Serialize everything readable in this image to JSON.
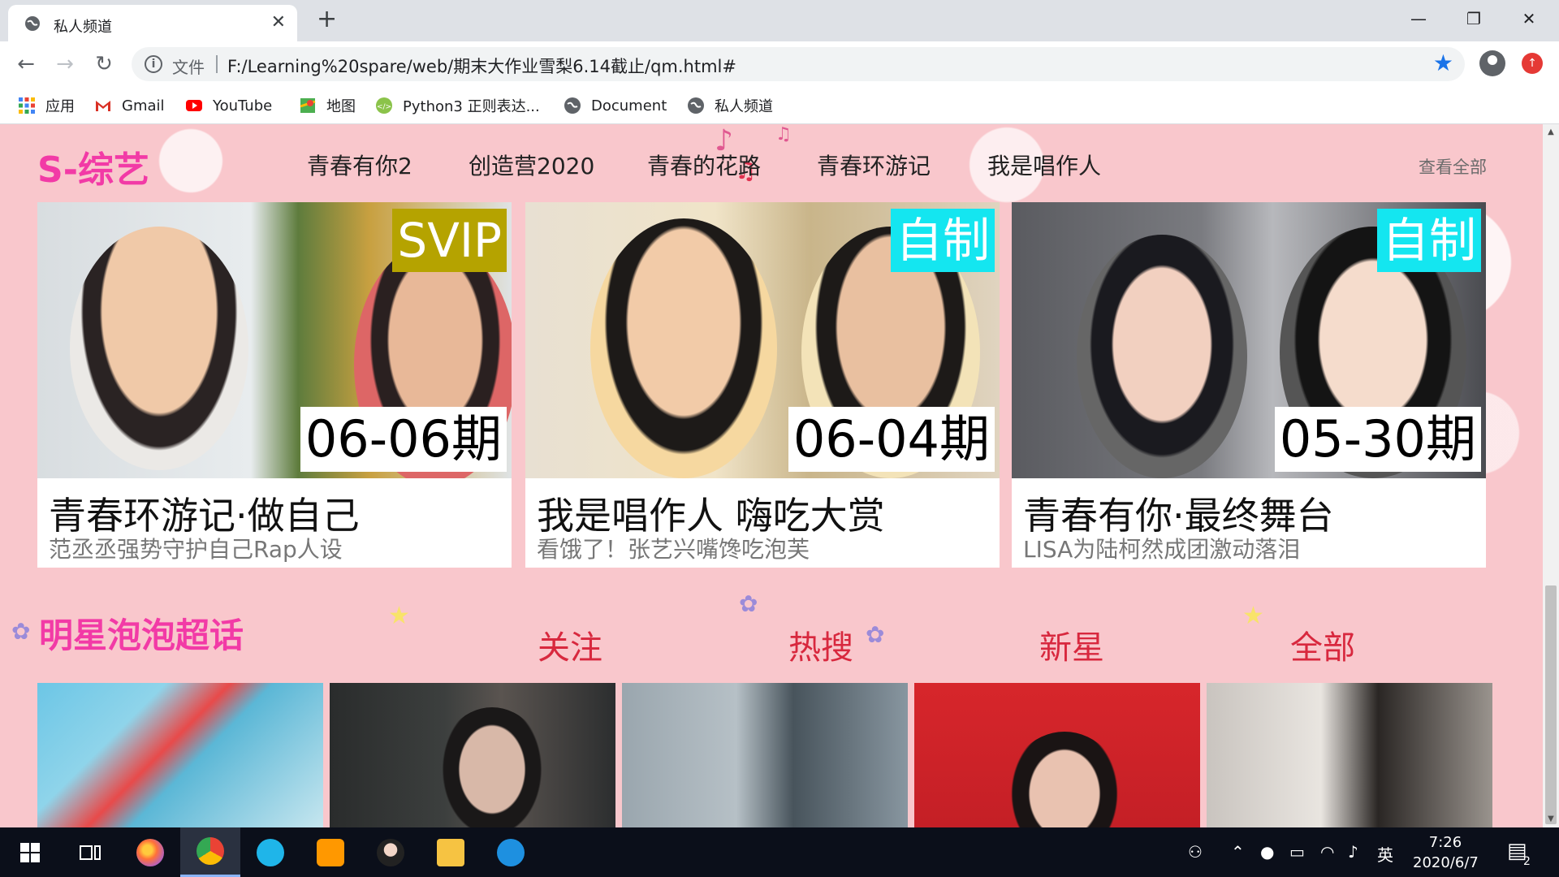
{
  "browser": {
    "tab_title": "私人频道",
    "close_glyph": "✕",
    "newtab_glyph": "+",
    "window_controls": [
      "—",
      "❐",
      "✕"
    ],
    "back_glyph": "←",
    "forward_glyph": "→",
    "reload_glyph": "↻",
    "info_glyph": "i",
    "file_label": "文件",
    "url": "F:/Learning%20spare/web/期末大作业雪梨6.14截止/qm.html#",
    "star_glyph": "★",
    "bookmarks": [
      {
        "label": "应用",
        "icon": "apps-grid-icon",
        "color": "#4285f4"
      },
      {
        "label": "Gmail",
        "icon": "gmail-icon",
        "color": "#d93025"
      },
      {
        "label": "YouTube",
        "icon": "youtube-icon",
        "color": "#ff0000"
      },
      {
        "label": "地图",
        "icon": "maps-icon",
        "color": "#34a853"
      },
      {
        "label": "Python3 正则表达...",
        "icon": "code-site-icon",
        "color": "#8bc34a"
      },
      {
        "label": "Document",
        "icon": "globe-icon",
        "color": "#5f6368"
      },
      {
        "label": "私人频道",
        "icon": "globe-icon",
        "color": "#5f6368"
      }
    ]
  },
  "variety": {
    "title": "S-综艺",
    "nav": [
      "青春有你2",
      "创造营2020",
      "青春的花路",
      "青春环游记",
      "我是唱作人"
    ],
    "see_all": "查看全部",
    "cards": [
      {
        "badge": "SVIP",
        "badge_color": "#b5a300",
        "episode": "06-06期",
        "title": "青春环游记·做自己",
        "subtitle": "范丞丞强势守护自己Rap人设"
      },
      {
        "badge": "自制",
        "badge_color": "#14e6f0",
        "episode": "06-04期",
        "title": "我是唱作人 嗨吃大赏",
        "subtitle": "看饿了！张艺兴嘴馋吃泡芙"
      },
      {
        "badge": "自制",
        "badge_color": "#14e6f0",
        "episode": "05-30期",
        "title": "青春有你·最终舞台",
        "subtitle": "LISA为陆柯然成团激动落泪"
      }
    ]
  },
  "stars": {
    "title": "明星泡泡超话",
    "tabs": [
      "关注",
      "热搜",
      "新星",
      "全部"
    ]
  },
  "taskbar": {
    "ime": "英",
    "time": "7:26",
    "date": "2020/6/7",
    "notifications": "2"
  },
  "colors": {
    "page_bg": "#f9c7cc",
    "section_title": "#f23aa6",
    "star_tab": "#d8283e"
  }
}
